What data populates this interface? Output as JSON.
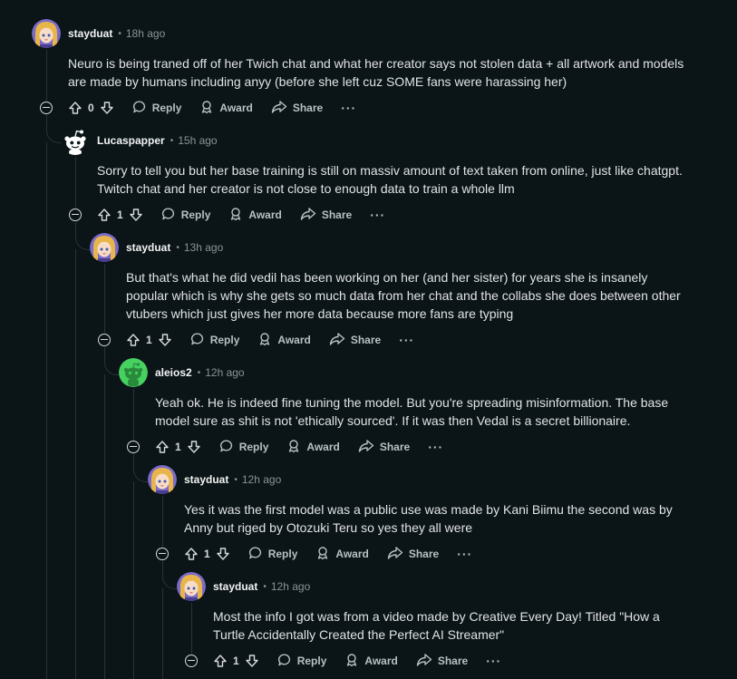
{
  "actions": {
    "reply": "Reply",
    "award": "Award",
    "share": "Share",
    "more": "···"
  },
  "comments": [
    {
      "username": "stayduat",
      "time": "18h ago",
      "avatar": "anime-avatar",
      "score": "0",
      "lines": [
        "Neuro is being traned off of her Twich chat and what her creator says not stolen data + all artwork and models",
        "are made by humans including anyy (before she left cuz SOME fans were harassing her)"
      ]
    },
    {
      "username": "Lucaspapper",
      "time": "15h ago",
      "avatar": "reddit-snoo-avatar",
      "score": "1",
      "lines": [
        "Sorry to tell you but her base training is still on massiv amount of text taken from online, just like chatgpt.",
        "Twitch chat and her creator is not close to enough data to train a whole llm"
      ]
    },
    {
      "username": "stayduat",
      "time": "13h ago",
      "avatar": "anime-avatar",
      "score": "1",
      "lines": [
        "But that's what he did vedil has been working on her (and her sister) for years she is insanely",
        "popular which is why she gets so much data from her chat and the collabs she does between other",
        "vtubers which just gives her more data because more fans are typing"
      ]
    },
    {
      "username": "aleios2",
      "time": "12h ago",
      "avatar": "green-snoo-avatar",
      "score": "1",
      "lines": [
        "Yeah ok. He is indeed fine tuning the model. But you're spreading misinformation. The base",
        "model sure as shit is not 'ethically sourced'. If it was then Vedal is a secret billionaire."
      ]
    },
    {
      "username": "stayduat",
      "time": "12h ago",
      "avatar": "anime-avatar",
      "score": "1",
      "lines": [
        "Yes it was the first model was a public use was made by Kani Biimu the second was by",
        "Anny but riged by Otozuki Teru so yes they all were"
      ]
    },
    {
      "username": "stayduat",
      "time": "12h ago",
      "avatar": "anime-avatar",
      "score": "1",
      "lines": [
        "Most the info I got was from a video made by Creative Every Day! Titled \"How a",
        "Turtle Accidentally Created the Perfect AI Streamer\""
      ]
    }
  ]
}
